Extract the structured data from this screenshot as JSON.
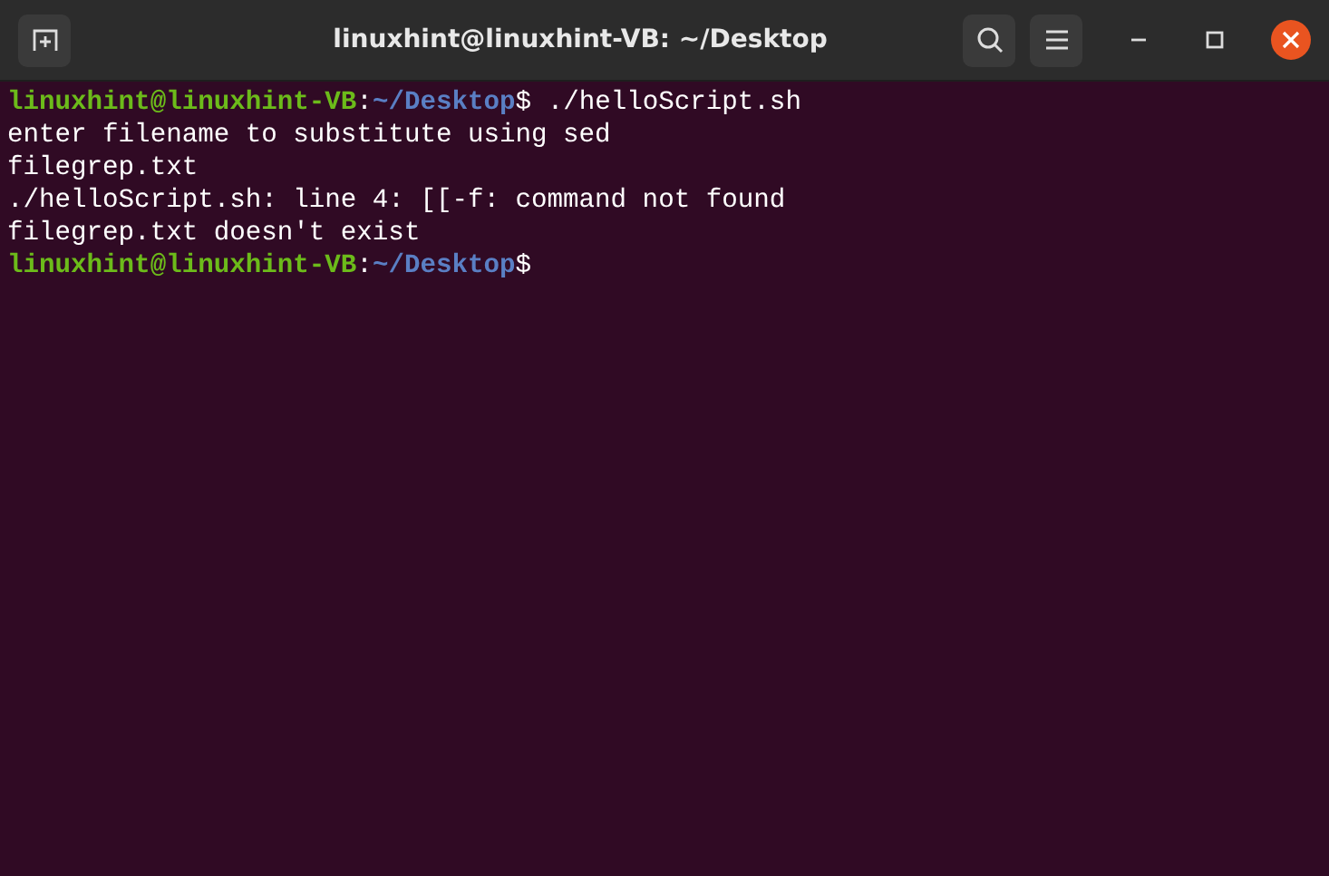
{
  "window": {
    "title": "linuxhint@linuxhint-VB: ~/Desktop"
  },
  "terminal": {
    "lines": [
      {
        "kind": "prompt",
        "user": "linuxhint@linuxhint-VB",
        "sep": ":",
        "path": "~/Desktop",
        "symbol": "$",
        "command": "./helloScript.sh"
      },
      {
        "kind": "output",
        "text": "enter filename to substitute using sed"
      },
      {
        "kind": "output",
        "text": "filegrep.txt"
      },
      {
        "kind": "output",
        "text": "./helloScript.sh: line 4: [[-f: command not found"
      },
      {
        "kind": "output",
        "text": "filegrep.txt doesn't exist"
      },
      {
        "kind": "prompt",
        "user": "linuxhint@linuxhint-VB",
        "sep": ":",
        "path": "~/Desktop",
        "symbol": "$"
      }
    ]
  }
}
